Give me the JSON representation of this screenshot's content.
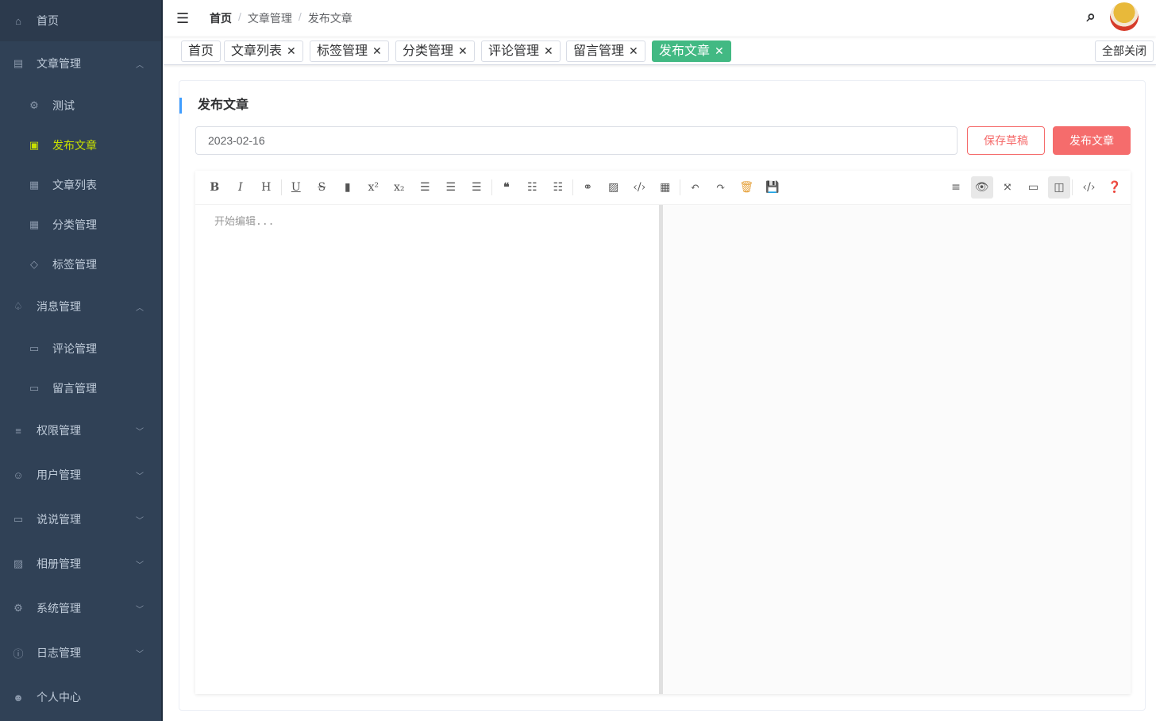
{
  "sidebar": {
    "items": [
      {
        "label": "首页",
        "icon": "home-icon",
        "ic": "⌂",
        "type": "home"
      },
      {
        "label": "文章管理",
        "icon": "document-icon",
        "ic": "▤",
        "arrow": "︿"
      },
      {
        "label": "测试",
        "icon": "gear-icon",
        "ic": "⚙",
        "type": "child"
      },
      {
        "label": "发布文章",
        "icon": "edit-icon",
        "ic": "▣",
        "type": "child",
        "active": true
      },
      {
        "label": "文章列表",
        "icon": "grid-icon",
        "ic": "▦",
        "type": "child"
      },
      {
        "label": "分类管理",
        "icon": "grid-icon",
        "ic": "▦",
        "type": "child"
      },
      {
        "label": "标签管理",
        "icon": "tag-icon",
        "ic": "◇",
        "type": "child"
      },
      {
        "label": "消息管理",
        "icon": "bell-icon",
        "ic": "♤",
        "arrow": "︿"
      },
      {
        "label": "评论管理",
        "icon": "comment-icon",
        "ic": "▭",
        "type": "child"
      },
      {
        "label": "留言管理",
        "icon": "comment-icon",
        "ic": "▭",
        "type": "child"
      },
      {
        "label": "权限管理",
        "icon": "menu-icon",
        "ic": "≡",
        "arrow": "﹀"
      },
      {
        "label": "用户管理",
        "icon": "users-icon",
        "ic": "☺",
        "arrow": "﹀"
      },
      {
        "label": "说说管理",
        "icon": "chat-icon",
        "ic": "▭",
        "arrow": "﹀"
      },
      {
        "label": "相册管理",
        "icon": "picture-icon",
        "ic": "▨",
        "arrow": "﹀"
      },
      {
        "label": "系统管理",
        "icon": "gear-icon",
        "ic": "⚙",
        "arrow": "﹀"
      },
      {
        "label": "日志管理",
        "icon": "info-icon",
        "ic": "ⓘ",
        "arrow": "﹀"
      },
      {
        "label": "个人中心",
        "icon": "user-icon",
        "ic": "☻"
      }
    ]
  },
  "header": {
    "breadcrumb": [
      "首页",
      "文章管理",
      "发布文章"
    ],
    "separator": "/"
  },
  "tags": {
    "items": [
      "首页",
      "文章列表",
      "标签管理",
      "分类管理",
      "评论管理",
      "留言管理",
      "发布文章"
    ],
    "close_all": "全部关闭",
    "accent": "#42b983"
  },
  "page": {
    "title": "发布文章",
    "title_value": "2023-02-16",
    "save_draft": "保存草稿",
    "publish": "发布文章",
    "placeholder": "开始编辑..."
  }
}
